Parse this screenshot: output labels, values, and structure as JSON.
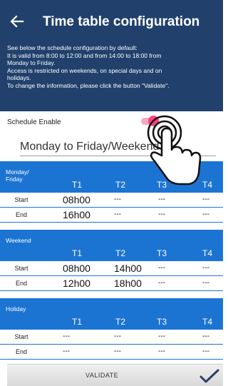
{
  "header": {
    "title": "Time table configuration",
    "description_lines": [
      "See below the schedule configuration by default:",
      " It is valid from 8:00 to 12:00 and from 14:00 to 18:00 from",
      "Monday to Friday.",
      " Access is restricted on weekends, on special days and on",
      "holidays.",
      " To change the information, please click the button \"Validate\"."
    ],
    "back_icon": "back-arrow-icon"
  },
  "schedule_enable": {
    "label": "Schedule Enable",
    "state": "on",
    "accent_color": "#ff4081"
  },
  "period_select": {
    "value": "Monday to Friday/Weekend"
  },
  "tables": [
    {
      "name_line1": "Monday/",
      "name_line2": "Friday",
      "columns": [
        "T1",
        "T2",
        "T3",
        "T4"
      ],
      "rows": [
        {
          "label": "Start",
          "cells": [
            "08h00",
            "---",
            "---",
            "---"
          ]
        },
        {
          "label": "End",
          "cells": [
            "16h00",
            "---",
            "---",
            "---"
          ]
        }
      ]
    },
    {
      "name_line1": "Weekend",
      "name_line2": "",
      "columns": [
        "T1",
        "T2",
        "T3",
        "T4"
      ],
      "rows": [
        {
          "label": "Start",
          "cells": [
            "08h00",
            "14h00",
            "---",
            "---"
          ]
        },
        {
          "label": "End",
          "cells": [
            "12h00",
            "18h00",
            "---",
            "---"
          ]
        }
      ]
    },
    {
      "name_line1": "Holiday",
      "name_line2": "",
      "columns": [
        "T1",
        "T2",
        "T3",
        "T4"
      ],
      "rows": [
        {
          "label": "Start",
          "cells": [
            "---",
            "---",
            "---",
            "---"
          ]
        },
        {
          "label": "End",
          "cells": [
            "---",
            "---",
            "---",
            "---"
          ]
        }
      ]
    }
  ],
  "footer": {
    "validate_label": "VALIDATE",
    "check_icon": "check-icon"
  },
  "colors": {
    "header_bg": "#21416c",
    "section_bg": "#1c74d2"
  }
}
